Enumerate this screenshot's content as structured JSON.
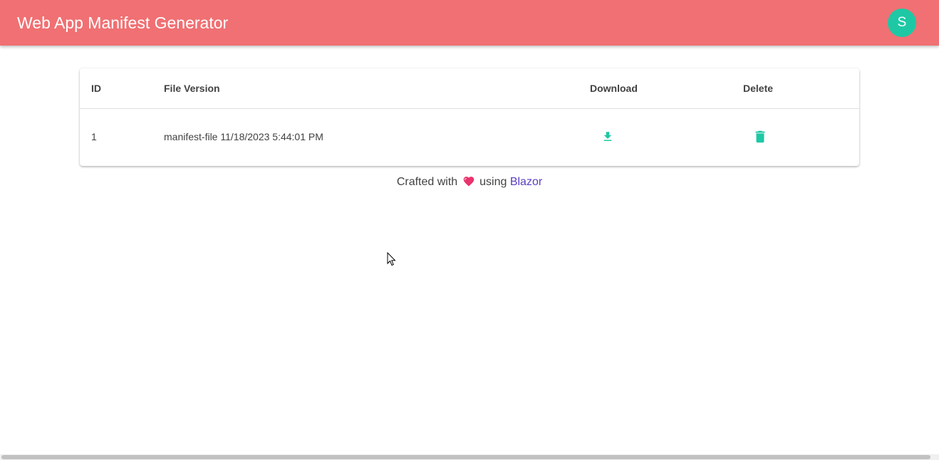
{
  "app": {
    "title": "Web App Manifest Generator",
    "avatar_initial": "S",
    "colors": {
      "appbar": "#f07073",
      "accent": "#1ec8a5",
      "link": "#5a3fc0"
    }
  },
  "table": {
    "columns": [
      "ID",
      "File Version",
      "Download",
      "Delete"
    ],
    "rows": [
      {
        "id": "1",
        "file_version": "manifest-file 11/18/2023 5:44:01 PM",
        "download_icon": "download-icon",
        "delete_icon": "trash-icon"
      }
    ]
  },
  "footer": {
    "prefix": "Crafted with",
    "heart_icon": "heart-icon",
    "middle": "using",
    "link_text": "Blazor"
  }
}
